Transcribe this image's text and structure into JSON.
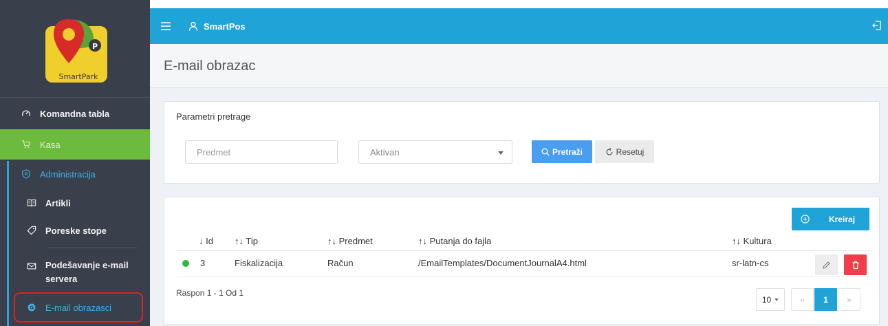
{
  "sidebar": {
    "logo_text": "SmartPark",
    "logo_badge": "P",
    "items": [
      {
        "label": "Komandna tabla",
        "icon": "dashboard-gauge-icon"
      },
      {
        "label": "Kasa",
        "icon": "cart-icon"
      },
      {
        "label": "Administracija",
        "icon": "shield-icon"
      },
      {
        "label": "Artikli",
        "icon": "book-icon"
      },
      {
        "label": "Poreske stope",
        "icon": "tag-icon"
      },
      {
        "label": "Podešavanje e-mail servera",
        "icon": "envelope-icon"
      },
      {
        "label": "E-mail obrazasci",
        "icon": "at-icon"
      }
    ]
  },
  "topbar": {
    "app_name": "SmartPos"
  },
  "page": {
    "title": "E-mail obrazac"
  },
  "search": {
    "title": "Parametri pretrage",
    "predmet_placeholder": "Predmet",
    "aktivan_value": "Aktivan",
    "search_label": "Pretraži",
    "reset_label": "Resetuj"
  },
  "table": {
    "create_label": "Kreiraj",
    "columns": [
      "↓ Id",
      "↑↓ Tip",
      "↑↓ Predmet",
      "↑↓ Putanja do fajla",
      "↑↓ Kultura"
    ],
    "rows": [
      {
        "id": "3",
        "tip": "Fiskalizacija",
        "predmet": "Račun",
        "putanja": "/EmailTemplates/DocumentJournalA4.html",
        "kultura": "sr-latn-cs",
        "active": true
      }
    ],
    "range_text": "Raspon 1 - 1 Od 1",
    "page_size": "10",
    "current_page": "1",
    "prev": "«",
    "next": "»"
  },
  "colors": {
    "sidebar": "#39404b",
    "topbar": "#20a4d8",
    "kasa_active": "#6dbb3c",
    "search_button": "#4a9ef0",
    "delete_button": "#ef3e4a",
    "status_active": "#2bbd3a",
    "highlight": "#e02020"
  }
}
